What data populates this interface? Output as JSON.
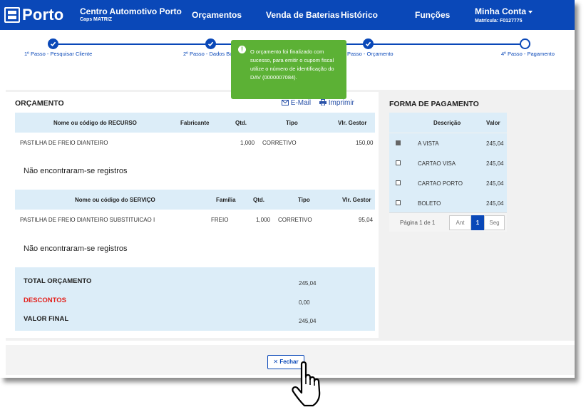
{
  "header": {
    "logo": "Porto",
    "center_name": "Centro Automotivo Porto",
    "center_sub": "Caps MATRIZ",
    "nav": [
      "Orçamentos",
      "Venda de Baterias",
      "Histórico",
      "Funções"
    ],
    "account": "Minha Conta",
    "registration": "Matrícula: F0127775"
  },
  "stepper": {
    "steps": [
      "1º Passo - Pesquisar Cliente",
      "2º Passo - Dados Básic",
      "3º Passo - Orçamento",
      "4º Passo - Pagamento"
    ],
    "completed": 3
  },
  "toast": {
    "message": "O orçamento foi finalizado com sucesso, para emitir o cupom fiscal utilize o número de identificação do DAV (0000007084).",
    "color": "#5cb135"
  },
  "budget": {
    "title": "ORÇAMENTO",
    "email": "E-Mail",
    "print": "Imprimir",
    "resources": {
      "columns": [
        "Nome ou código do RECURSO",
        "Fabricante",
        "Qtd.",
        "Tipo",
        "Vlr. Gestor"
      ],
      "rows": [
        [
          "PASTILHA DE FREIO DIANTEIRO",
          "",
          "1,000",
          "CORRETIVO",
          "150,00"
        ]
      ],
      "empty": "Não encontraram-se registros"
    },
    "services": {
      "columns": [
        "Nome ou código do SERVIÇO",
        "Família",
        "Qtd.",
        "Tipo",
        "Vlr. Gestor"
      ],
      "rows": [
        [
          "PASTILHA DE FREIO DIANTEIRO SUBSTITUICAO I",
          "FREIO",
          "1,000",
          "CORRETIVO",
          "95,04"
        ]
      ],
      "empty": "Não encontraram-se registros"
    },
    "totals": {
      "total_label": "TOTAL ORÇAMENTO",
      "total_value": "245,04",
      "discount_label": "DESCONTOS",
      "discount_value": "0,00",
      "final_label": "VALOR FINAL",
      "final_value": "245,04"
    }
  },
  "payment": {
    "title": "FORMA DE PAGAMENTO",
    "columns": [
      "Descrição",
      "Valor"
    ],
    "rows": [
      {
        "name": "A VISTA",
        "value": "245,04",
        "checked": true
      },
      {
        "name": "CARTAO VISA",
        "value": "245,04",
        "checked": false
      },
      {
        "name": "CARTAO PORTO",
        "value": "245,04",
        "checked": false
      },
      {
        "name": "BOLETO",
        "value": "245,04",
        "checked": false
      }
    ],
    "pager": {
      "label": "Página 1 de 1",
      "prev": "Ant",
      "page": "1",
      "next": "Seg"
    }
  },
  "footer": {
    "close": "✕ Fechar"
  },
  "colors": {
    "brand": "#0a48b8",
    "row_bg": "#dcedf8",
    "discount": "#e3201b",
    "link": "#2a52a8"
  }
}
